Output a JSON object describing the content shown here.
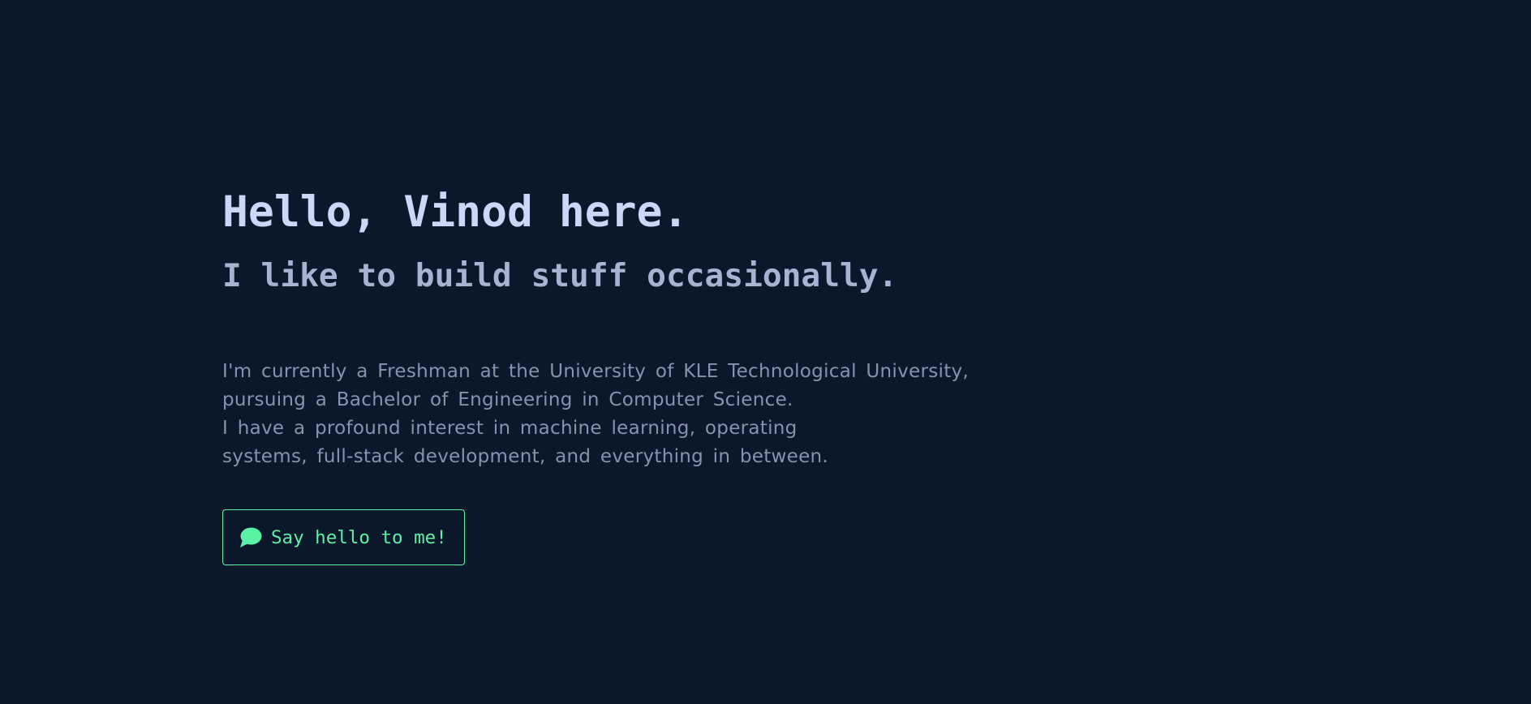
{
  "hero": {
    "greeting": "Hello, Vinod here.",
    "tagline": "I like to build stuff occasionally.",
    "bio_lines": [
      "I'm currently a Freshman at the University of KLE Technological University,",
      "pursuing a Bachelor of Engineering in Computer Science.",
      "I have a profound interest in machine learning, operating",
      "systems, full-stack development, and everything in between."
    ],
    "cta": {
      "label": "Say hello to me!",
      "icon": "speech-bubble-icon"
    }
  },
  "colors": {
    "background": "#0b172a",
    "heading": "#ccd6f6",
    "subheading": "#a8b2d1",
    "body_text": "#8892b0",
    "accent": "#5cf2a6"
  }
}
